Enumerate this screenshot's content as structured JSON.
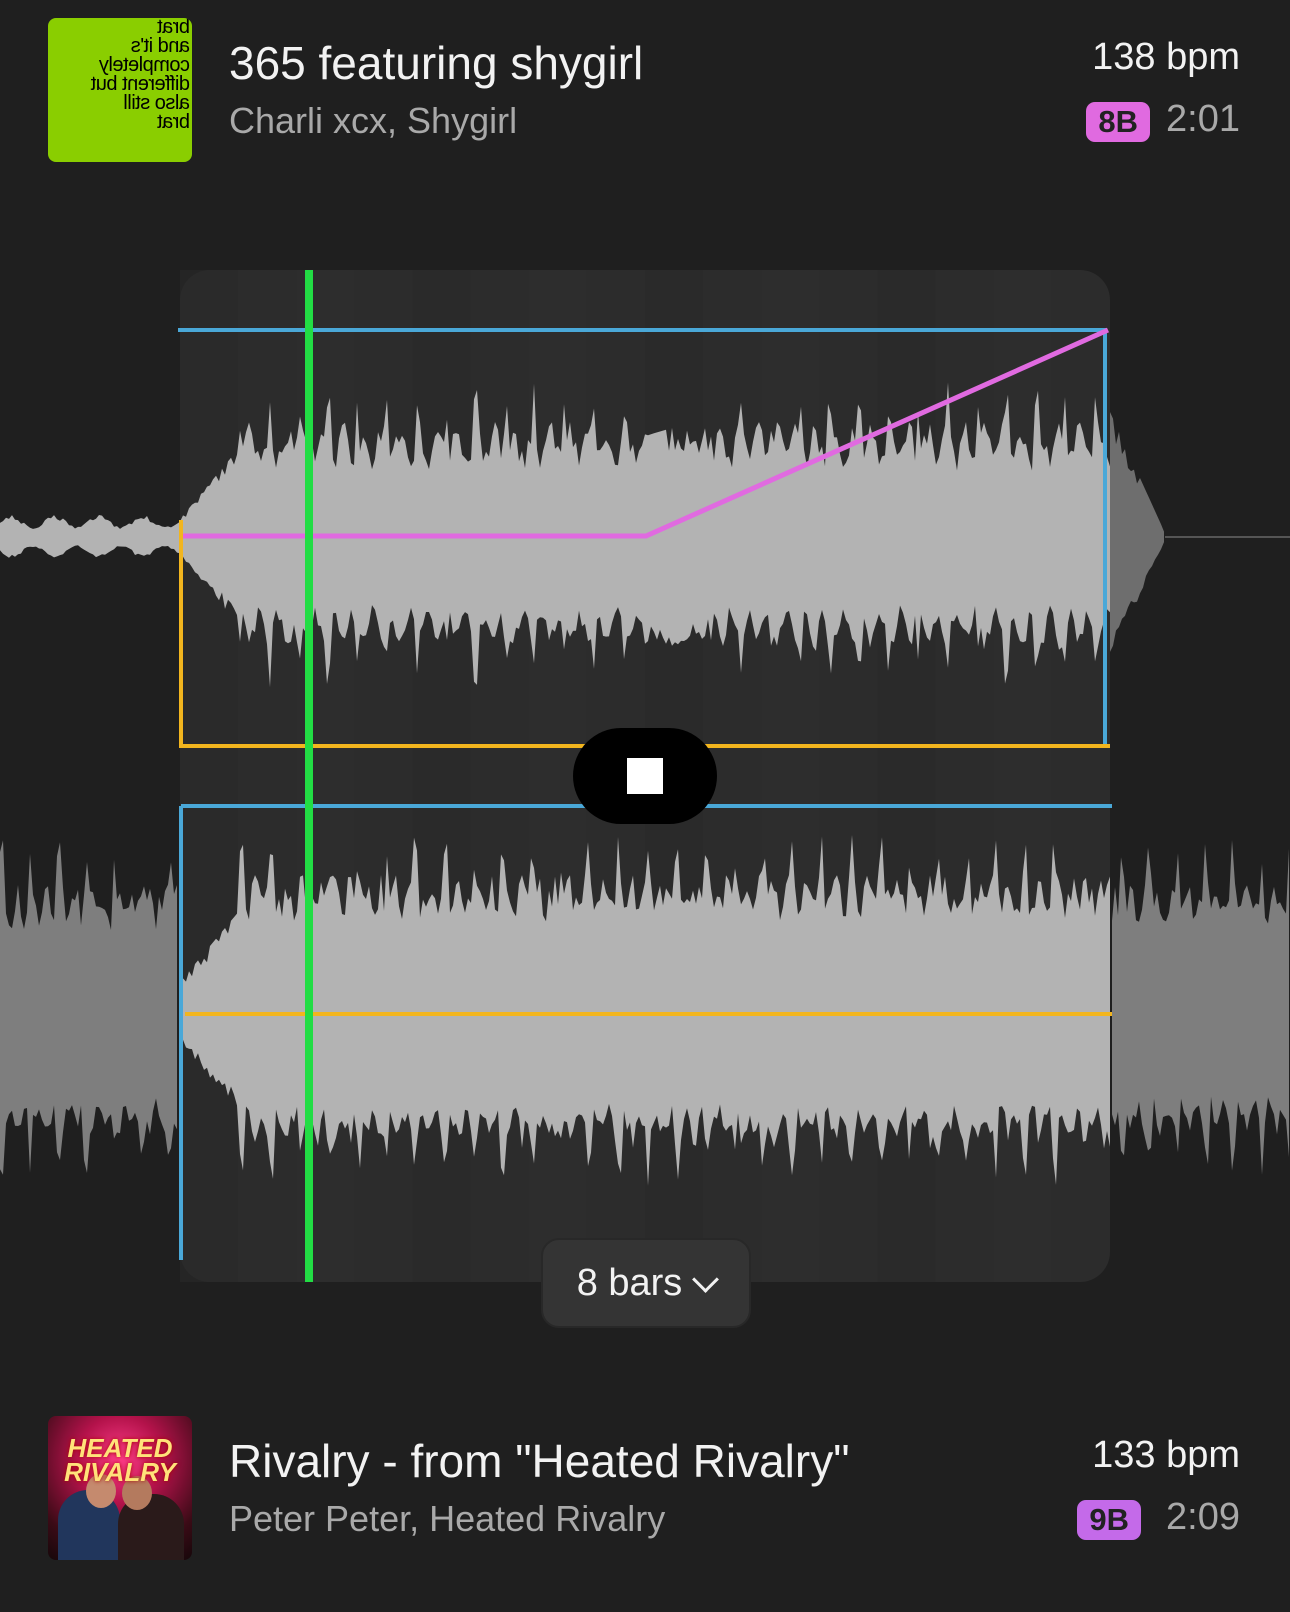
{
  "track_current": {
    "title": "365 featuring shygirl",
    "artist": "Charli xcx, Shygirl",
    "bpm": "138 bpm",
    "key": "8B",
    "duration": "2:01",
    "album_art_text": [
      "brat",
      "and it's",
      "completely",
      "different but",
      "also still",
      "brat"
    ]
  },
  "track_next": {
    "title": "Rivalry - from \"Heated Rivalry\"",
    "artist": "Peter Peter, Heated Rivalry",
    "bpm": "133 bpm",
    "key": "9B",
    "duration": "2:09",
    "album_art_text": "HEATED RIVALRY"
  },
  "transition": {
    "length_label": "8 bars",
    "state": "playing"
  },
  "colors": {
    "background": "#1f1f1f",
    "panel": "#2c2c2c",
    "waveform": "#b3b3b3",
    "playhead": "#22dd44",
    "volume_line": "#4aa8d8",
    "eq_line": "#f2b51e",
    "tempo_line": "#e06ae0",
    "key_8b": "#e06ae0",
    "key_9b": "#c46ae9"
  }
}
